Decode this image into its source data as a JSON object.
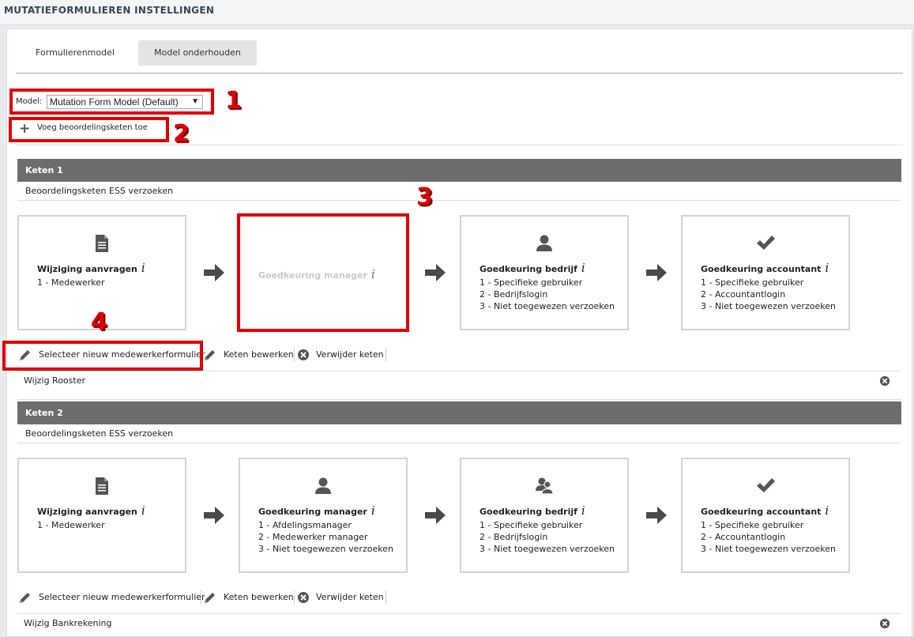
{
  "page": {
    "title": "MUTATIEFORMULIEREN INSTELLINGEN"
  },
  "tabs": [
    {
      "label": "Formulierenmodel"
    },
    {
      "label": "Model onderhouden"
    }
  ],
  "model": {
    "label": "Model:",
    "selected": "Mutation Form Model (Default)"
  },
  "add_chain": {
    "label": "Voeg beoordelingsketen toe"
  },
  "annotations": [
    "1",
    "2",
    "3",
    "4"
  ],
  "chains": [
    {
      "header": "Keten 1",
      "description": "Beoordelingsketen ESS verzoeken",
      "steps": [
        {
          "icon": "document-icon",
          "title": "Wijziging aanvragen",
          "lines": [
            "1 - Medewerker"
          ]
        },
        {
          "icon": "",
          "title": "Goedkeuring manager",
          "lines": []
        },
        {
          "icon": "user-icon",
          "title": "Goedkeuring bedrijf",
          "lines": [
            "1 - Specifieke gebruiker",
            "2 - Bedrijfslogin",
            "3 - Niet toegewezen verzoeken"
          ]
        },
        {
          "icon": "checkmark-icon",
          "title": "Goedkeuring accountant",
          "lines": [
            "1 - Specifieke gebruiker",
            "2 - Accountantlogin",
            "3 - Niet toegewezen verzoeken"
          ]
        }
      ],
      "actions": {
        "select_form": "Selecteer nieuw medewerkerformulier",
        "edit": "Keten bewerken",
        "delete": "Verwijder keten"
      },
      "form": "Wijzig Rooster"
    },
    {
      "header": "Keten 2",
      "description": "Beoordelingsketen ESS verzoeken",
      "steps": [
        {
          "icon": "document-icon",
          "title": "Wijziging aanvragen",
          "lines": [
            "1 - Medewerker"
          ]
        },
        {
          "icon": "user-icon",
          "title": "Goedkeuring manager",
          "lines": [
            "1 - Afdelingsmanager",
            "2 - Medewerker manager",
            "3 - Niet toegewezen verzoeken"
          ]
        },
        {
          "icon": "users-icon",
          "title": "Goedkeuring bedrijf",
          "lines": [
            "1 - Specifieke gebruiker",
            "2 - Bedrijfslogin",
            "3 - Niet toegewezen verzoeken"
          ]
        },
        {
          "icon": "checkmark-icon",
          "title": "Goedkeuring accountant",
          "lines": [
            "1 - Specifieke gebruiker",
            "2 - Accountantlogin",
            "3 - Niet toegewezen verzoeken"
          ]
        }
      ],
      "actions": {
        "select_form": "Selecteer nieuw medewerkerformulier",
        "edit": "Keten bewerken",
        "delete": "Verwijder keten"
      },
      "form": "Wijzig Bankrekening"
    }
  ],
  "info_glyph": "i",
  "colors": {
    "chain_header": "#6d6d6d",
    "annotation_red": "#e00000",
    "step_border": "#d4d4d4"
  }
}
